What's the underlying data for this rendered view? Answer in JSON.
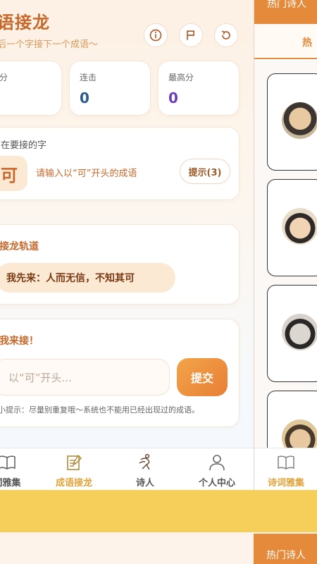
{
  "header": {
    "title": "语接龙",
    "subtitle": "后一个字接下一个成语～"
  },
  "stats": [
    {
      "label": "分",
      "value": "",
      "color": "#2a5c8c"
    },
    {
      "label": "连击",
      "value": "0",
      "color": "#2a5c8c"
    },
    {
      "label": "最高分",
      "value": "0",
      "color": "#6b3fb5"
    }
  ],
  "current": {
    "label": "在要接的字",
    "char": "可",
    "hint": "请输入以“可”开头的成语",
    "hint_button": "提示(3)"
  },
  "chain": {
    "title": "接龙轨道",
    "first": "我先来：人而无信，不知其可"
  },
  "answer": {
    "title": "我来接！",
    "placeholder": "以“可”开头...",
    "submit": "提交",
    "tip": "小提示：尽量别重复哦～系统也不能用已经出现过的成语。"
  },
  "tabs": [
    {
      "label": "词雅集",
      "active": false
    },
    {
      "label": "成语接龙",
      "active": true
    },
    {
      "label": "诗人",
      "active": false
    },
    {
      "label": "个人中心",
      "active": false
    }
  ],
  "right_panel": {
    "top_label": "热门诗人",
    "tab_label": "热",
    "tab_bar_label": "诗词雅集",
    "bottom_label": "热门诗人"
  },
  "colors": {
    "accent": "#c8682a",
    "orange": "#e48a3a",
    "yellow_band": "#f5cf5a"
  }
}
